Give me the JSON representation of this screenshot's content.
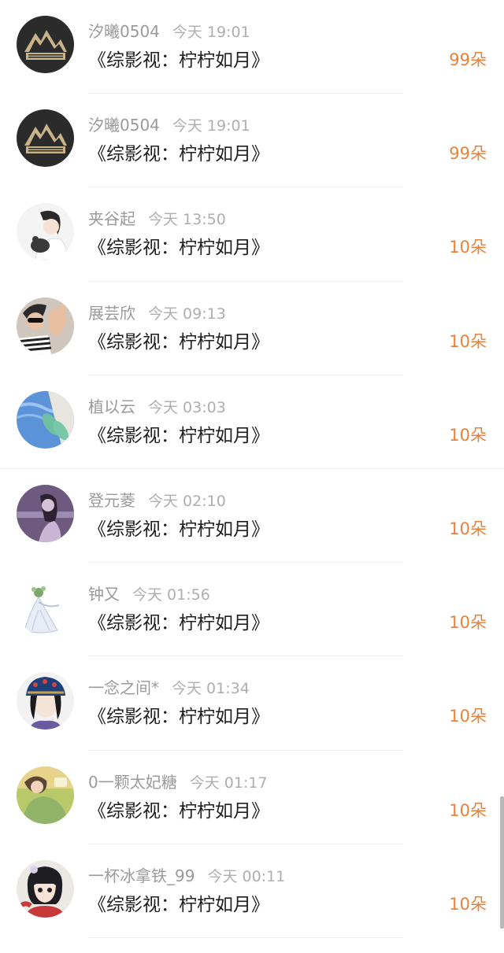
{
  "gift_list": {
    "items": [
      {
        "username": "汐曦0504",
        "time": "今天 19:01",
        "title": "《综影视：柠柠如月》",
        "amount": "99朵",
        "avatar_icon": "logo-avatar"
      },
      {
        "username": "汐曦0504",
        "time": "今天 19:01",
        "title": "《综影视：柠柠如月》",
        "amount": "99朵",
        "avatar_icon": "logo-avatar"
      },
      {
        "username": "夹谷起",
        "time": "今天 13:50",
        "title": "《综影视：柠柠如月》",
        "amount": "10朵",
        "avatar_icon": "girl-with-cat-avatar"
      },
      {
        "username": "展芸欣",
        "time": "今天 09:13",
        "title": "《综影视：柠柠如月》",
        "amount": "10朵",
        "avatar_icon": "sunglasses-person-avatar"
      },
      {
        "username": "植以云",
        "time": "今天 03:03",
        "title": "《综影视：柠柠如月》",
        "amount": "10朵",
        "avatar_icon": "pool-avatar"
      },
      {
        "username": "登元菱",
        "time": "今天 02:10",
        "title": "《综影视：柠柠如月》",
        "amount": "10朵",
        "avatar_icon": "purple-portrait-avatar"
      },
      {
        "username": "钟又",
        "time": "今天 01:56",
        "title": "《综影视：柠柠如月》",
        "amount": "10朵",
        "avatar_icon": "fairy-illustration-avatar"
      },
      {
        "username": "一念之间*",
        "time": "今天 01:34",
        "title": "《综影视：柠柠如月》",
        "amount": "10朵",
        "avatar_icon": "qing-princess-avatar"
      },
      {
        "username": "0一颗太妃糖",
        "time": "今天 01:17",
        "title": "《综影视：柠柠如月》",
        "amount": "10朵",
        "avatar_icon": "green-illustration-avatar"
      },
      {
        "username": "一杯冰拿铁_99",
        "time": "今天 00:11",
        "title": "《综影视：柠柠如月》",
        "amount": "10朵",
        "avatar_icon": "cartoon-girl-avatar"
      }
    ]
  },
  "colors": {
    "amount": "#e8823a",
    "meta_text": "#9a9a9a",
    "title_text": "#1f1f1f"
  }
}
